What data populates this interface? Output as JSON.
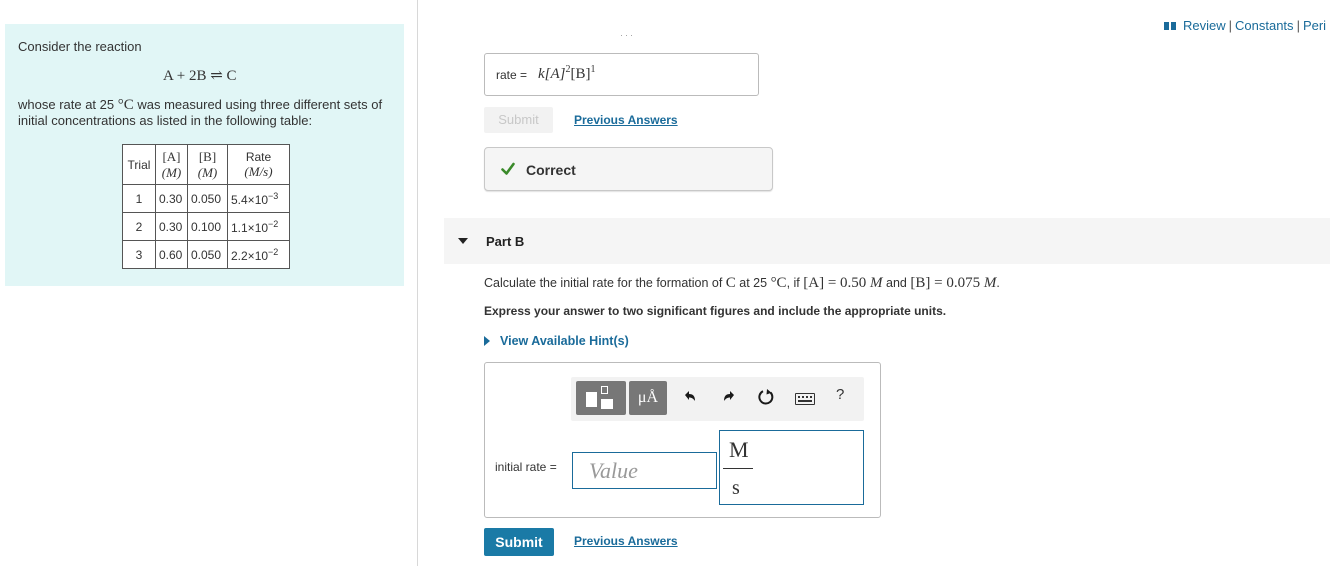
{
  "top_links": {
    "review": "Review",
    "sep": "|",
    "constants": "Constants",
    "periodic": "Peri"
  },
  "problem": {
    "intro": "Consider the reaction",
    "reaction": "A + 2B ⇌ C",
    "desc_before": "whose rate at 25",
    "temp_unit": "°C",
    "desc_after": " was measured using three different sets of initial concentrations as listed in the following table:",
    "table": {
      "headers": {
        "trial": "Trial",
        "a_sym": "[A]",
        "a_unit": "(M)",
        "b_sym": "[B]",
        "b_unit": "(M)",
        "rate": "Rate",
        "rate_unit": "(M/s)"
      },
      "rows": [
        {
          "trial": "1",
          "a": "0.30",
          "b": "0.050",
          "rate_base": "5.4×10",
          "rate_exp": "−3"
        },
        {
          "trial": "2",
          "a": "0.30",
          "b": "0.100",
          "rate_base": "1.1×10",
          "rate_exp": "−2"
        },
        {
          "trial": "3",
          "a": "0.60",
          "b": "0.050",
          "rate_base": "2.2×10",
          "rate_exp": "−2"
        }
      ]
    }
  },
  "part_a": {
    "rate_label": "rate =",
    "rate_k": "k[A]",
    "rate_exp1": "2",
    "rate_b": "[B]",
    "rate_exp2": "1",
    "submit_label": "Submit",
    "previous_answers": "Previous Answers",
    "feedback": "Correct"
  },
  "part_b": {
    "title": "Part B",
    "question_1": "Calculate the initial rate for the formation of ",
    "q_c": "C",
    "question_2": " at 25 ",
    "q_tempunit": "°C",
    "question_3": ", if ",
    "q_a": "[A] = 0.50 ",
    "q_m1": "M",
    "question_4": " and ",
    "q_b": "[B] = 0.075 ",
    "q_m2": "M",
    "question_5": ".",
    "instruction": "Express your answer to two significant figures and include the appropriate units.",
    "hints_label": "View Available Hint(s)",
    "toolbar": {
      "units_label": "μÅ",
      "help_label": "?"
    },
    "input_label": "initial rate =",
    "value_placeholder": "Value",
    "unit_numerator": "M",
    "unit_denominator": "s",
    "submit_label": "Submit",
    "previous_answers": "Previous Answers"
  },
  "colors": {
    "panel_bg": "#e1f6f6",
    "link": "#1a6b9a",
    "submit_bg": "#1a7aa6",
    "check": "#3a8a2a"
  },
  "icons": [
    "book-icon",
    "check-icon",
    "caret-down-icon",
    "caret-right-icon",
    "templates-icon",
    "undo-icon",
    "redo-icon",
    "reset-icon",
    "keyboard-icon",
    "help-icon"
  ]
}
